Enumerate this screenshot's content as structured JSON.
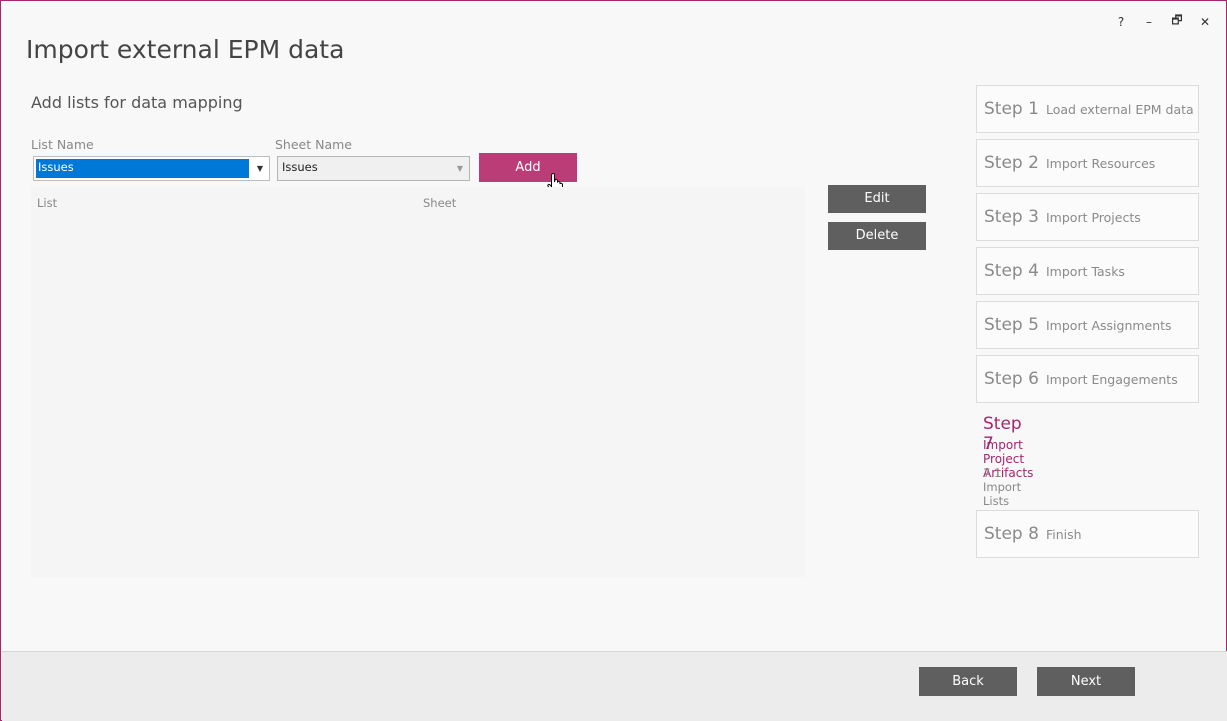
{
  "window": {
    "controls": {
      "help": "?",
      "minimize": "–",
      "restore": "🗗",
      "close": "✕"
    },
    "accent_color": "#a5256e"
  },
  "title": "Import external EPM data",
  "subtitle": "Add lists for data mapping",
  "form": {
    "list_name_label": "List Name",
    "list_name_value": "Issues",
    "sheet_name_label": "Sheet Name",
    "sheet_name_value": "Issues",
    "add_label": "Add"
  },
  "grid": {
    "col_list": "List",
    "col_sheet": "Sheet"
  },
  "actions": {
    "edit_label": "Edit",
    "delete_label": "Delete"
  },
  "steps": [
    {
      "num": "Step 1",
      "label": "Load external EPM data"
    },
    {
      "num": "Step 2",
      "label": "Import Resources"
    },
    {
      "num": "Step 3",
      "label": "Import Projects"
    },
    {
      "num": "Step 4",
      "label": "Import Tasks"
    },
    {
      "num": "Step 5",
      "label": "Import Assignments"
    },
    {
      "num": "Step 6",
      "label": "Import Engagements"
    }
  ],
  "active_step": {
    "num": "Step 7",
    "label": "Import Project Artifacts",
    "substep": "7.1 Import Lists"
  },
  "final_step": {
    "num": "Step 8",
    "label": "Finish"
  },
  "footer": {
    "back_label": "Back",
    "next_label": "Next"
  }
}
